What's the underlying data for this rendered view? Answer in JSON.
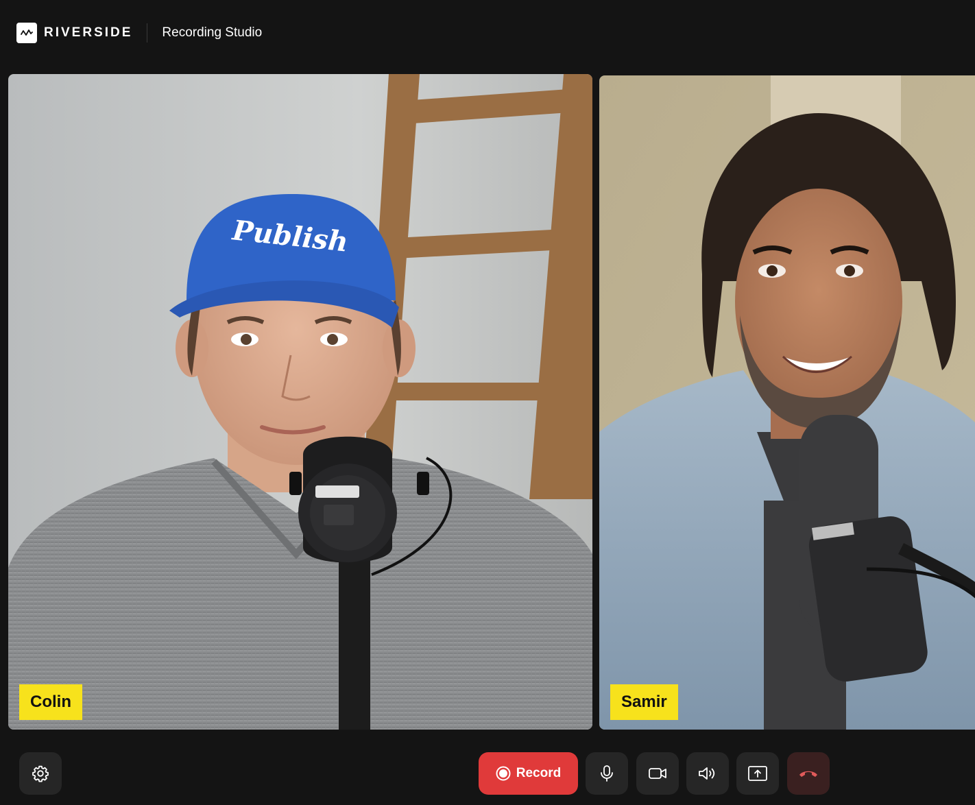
{
  "header": {
    "brand": "RIVERSIDE",
    "title": "Recording Studio"
  },
  "participants": [
    {
      "name": "Colin",
      "cap_text": "Publish"
    },
    {
      "name": "Samir"
    }
  ],
  "controls": {
    "record_label": "Record",
    "icons": [
      "gear-icon",
      "record-icon",
      "microphone-icon",
      "camera-icon",
      "speaker-icon",
      "share-screen-icon",
      "hang-up-icon"
    ]
  },
  "colors": {
    "background": "#141414",
    "record": "#e03a3a",
    "name_tag": "#f7e21c",
    "hang_up": "#e05a5a"
  }
}
